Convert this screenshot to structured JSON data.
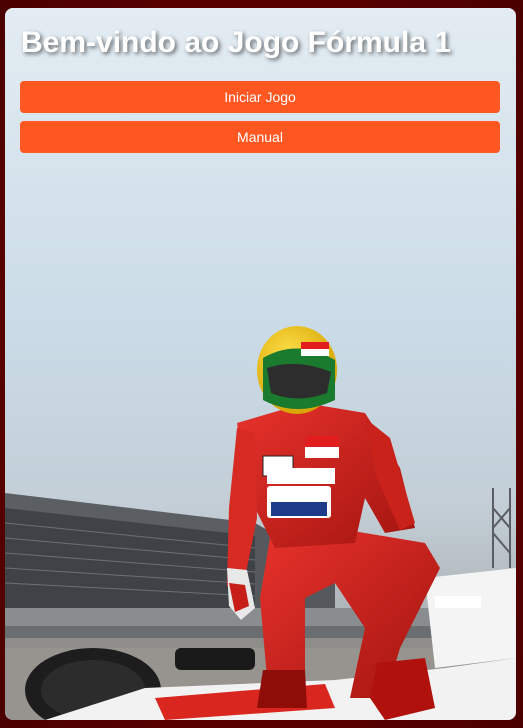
{
  "header": {
    "title": "Bem-vindo ao Jogo Fórmula 1"
  },
  "menu": {
    "start_label": "Iniciar Jogo",
    "manual_label": "Manual"
  },
  "theme": {
    "accent": "#ff5722",
    "frame": "#5a0000"
  }
}
